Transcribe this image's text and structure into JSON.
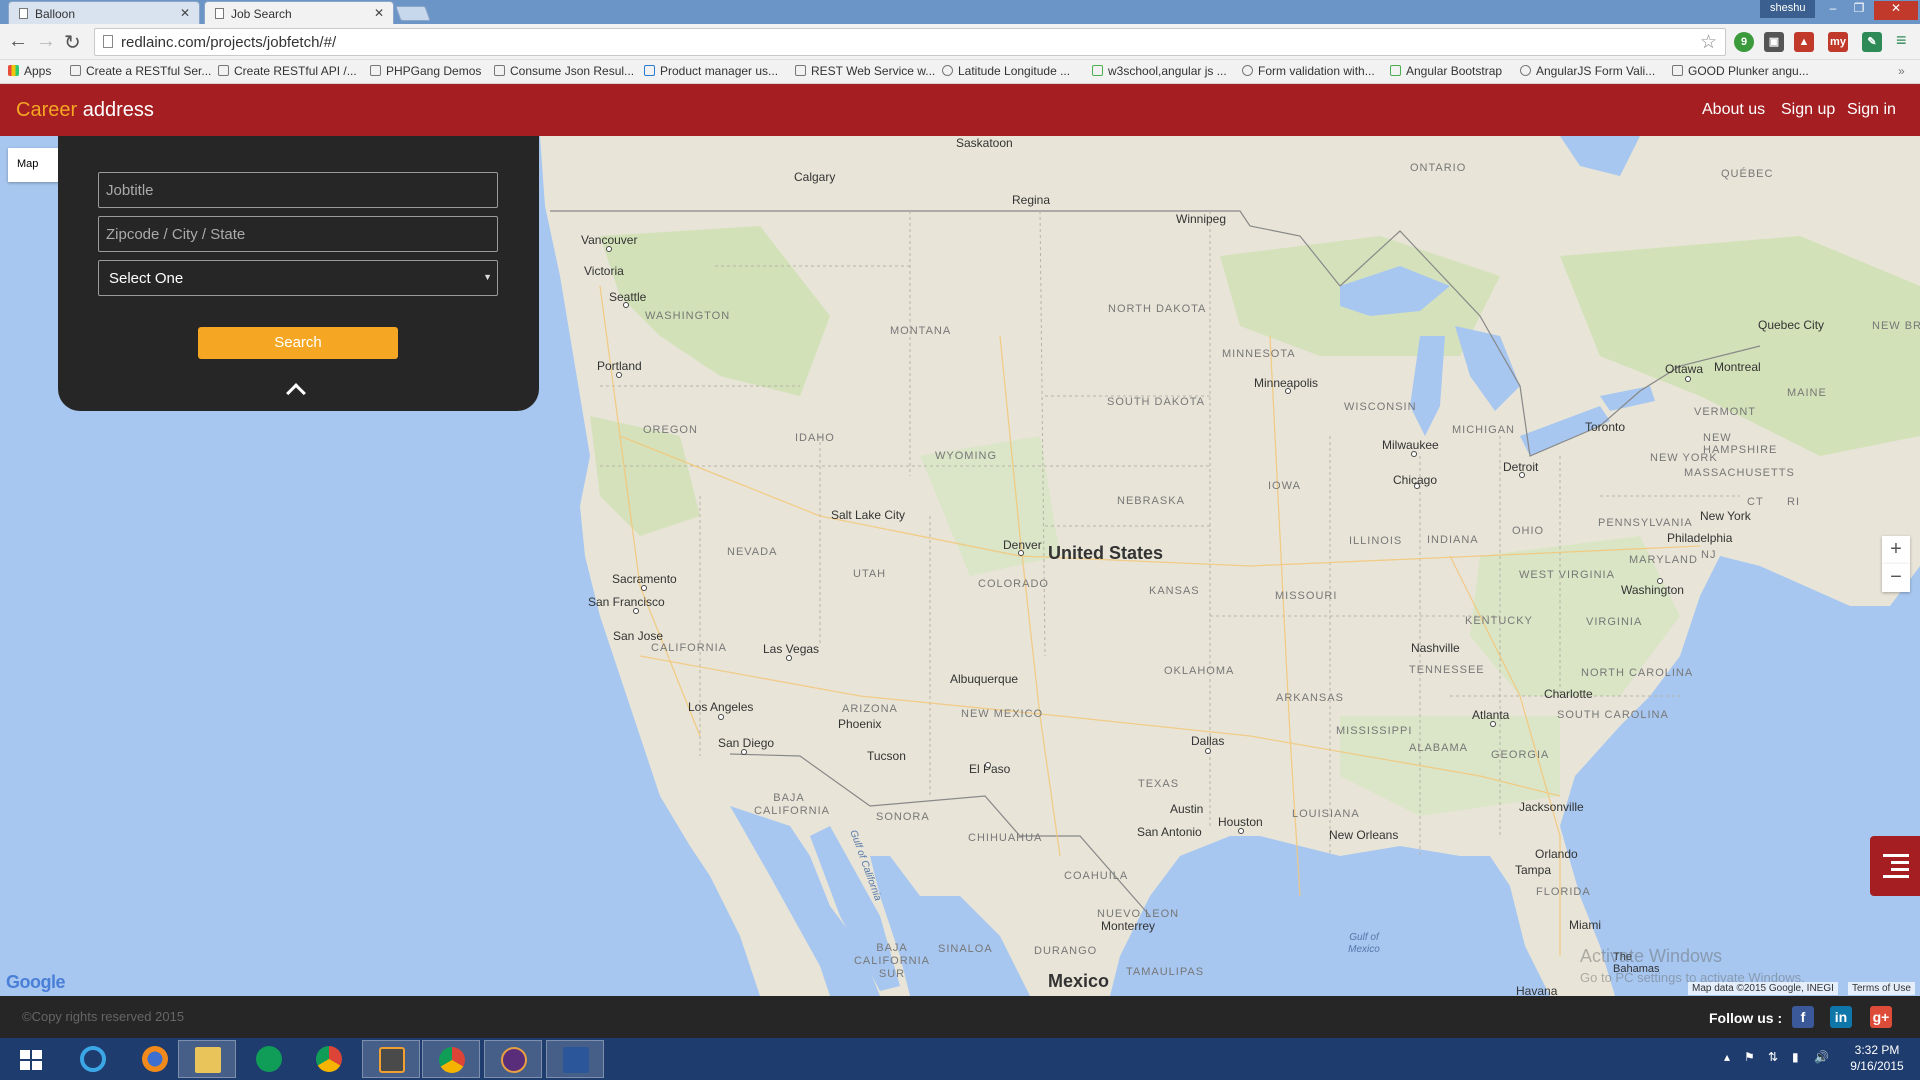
{
  "browser": {
    "tabs": [
      {
        "label": "Balloon",
        "active": false
      },
      {
        "label": "Job Search",
        "active": true
      }
    ],
    "user": "sheshu",
    "url": "redlainc.com/projects/jobfetch/#/",
    "bookmarks": [
      "Apps",
      "Create a RESTful Ser...",
      "Create RESTful API /...",
      "PHPGang Demos",
      "Consume Json Resul...",
      "Product manager us...",
      "REST Web Service w...",
      "Latitude Longitude ...",
      "w3school,angular js ...",
      "Form validation with...",
      "Angular Bootstrap",
      "AngularJS Form Vali...",
      "GOOD Plunker angu..."
    ]
  },
  "header": {
    "brand_part1": "Career",
    "brand_part2": "address",
    "nav": [
      "About us",
      "Sign up",
      "Sign in"
    ]
  },
  "search": {
    "jobtitle_placeholder": "Jobtitle",
    "location_placeholder": "Zipcode / City / State",
    "select_value": "Select One",
    "button": "Search"
  },
  "map": {
    "type_button": "Map",
    "zoom_in": "+",
    "zoom_out": "−",
    "country_label": "United States",
    "mexico_label": "Mexico",
    "attribution": "Map data ©2015 Google, INEGI",
    "terms": "Terms of Use",
    "logo": "Google",
    "watermark_title": "Activate Windows",
    "watermark_sub": "Go to PC settings to activate Windows.",
    "states": [
      "WASHINGTON",
      "OREGON",
      "IDAHO",
      "MONTANA",
      "WYOMING",
      "NEVADA",
      "UTAH",
      "COLORADO",
      "CALIFORNIA",
      "ARIZONA",
      "NEW MEXICO",
      "NORTH DAKOTA",
      "SOUTH DAKOTA",
      "NEBRASKA",
      "KANSAS",
      "OKLAHOMA",
      "TEXAS",
      "MINNESOTA",
      "IOWA",
      "MISSOURI",
      "ARKANSAS",
      "LOUISIANA",
      "WISCONSIN",
      "ILLINOIS",
      "MICHIGAN",
      "INDIANA",
      "OHIO",
      "KENTUCKY",
      "TENNESSEE",
      "MISSISSIPPI",
      "ALABAMA",
      "GEORGIA",
      "FLORIDA",
      "SOUTH CAROLINA",
      "NORTH CAROLINA",
      "VIRGINIA",
      "WEST VIRGINIA",
      "PENNSYLVANIA",
      "NEW YORK",
      "VERMONT",
      "NEW HAMPSHIRE",
      "MASSACHUSETTS",
      "MAINE",
      "MARYLAND",
      "NJ",
      "CT",
      "RI",
      "ONTARIO",
      "QUÉBEC",
      "BAJA CALIFORNIA",
      "SONORA",
      "CHIHUAHUA",
      "COAHUILA",
      "NUEVO LEON",
      "BAJA CALIFORNIA SUR",
      "SINALOA",
      "DURANGO",
      "TAMAULIPAS",
      "NEW BRUNSW"
    ],
    "cities": [
      "Saskatoon",
      "Calgary",
      "Regina",
      "Winnipeg",
      "Vancouver",
      "Victoria",
      "Seattle",
      "Portland",
      "Salt Lake City",
      "Denver",
      "Sacramento",
      "San Francisco",
      "San Jose",
      "Las Vegas",
      "Los Angeles",
      "San Diego",
      "Phoenix",
      "Tucson",
      "Albuquerque",
      "El Paso",
      "Dallas",
      "Austin",
      "San Antonio",
      "Houston",
      "New Orleans",
      "Minneapolis",
      "Milwaukee",
      "Chicago",
      "Detroit",
      "Toronto",
      "Ottawa",
      "Montreal",
      "Quebec City",
      "New York",
      "Philadelphia",
      "Washington",
      "Nashville",
      "Atlanta",
      "Charlotte",
      "Jacksonville",
      "Orlando",
      "Tampa",
      "Miami",
      "Monterrey",
      "Havana",
      "The Bahamas"
    ],
    "water": [
      "Gulf of California",
      "Gulf of Mexico"
    ]
  },
  "footer": {
    "copyright": "©Copy rights reserved 2015",
    "follow": "Follow us :"
  },
  "taskbar": {
    "time": "3:32 PM",
    "date": "9/16/2015"
  }
}
